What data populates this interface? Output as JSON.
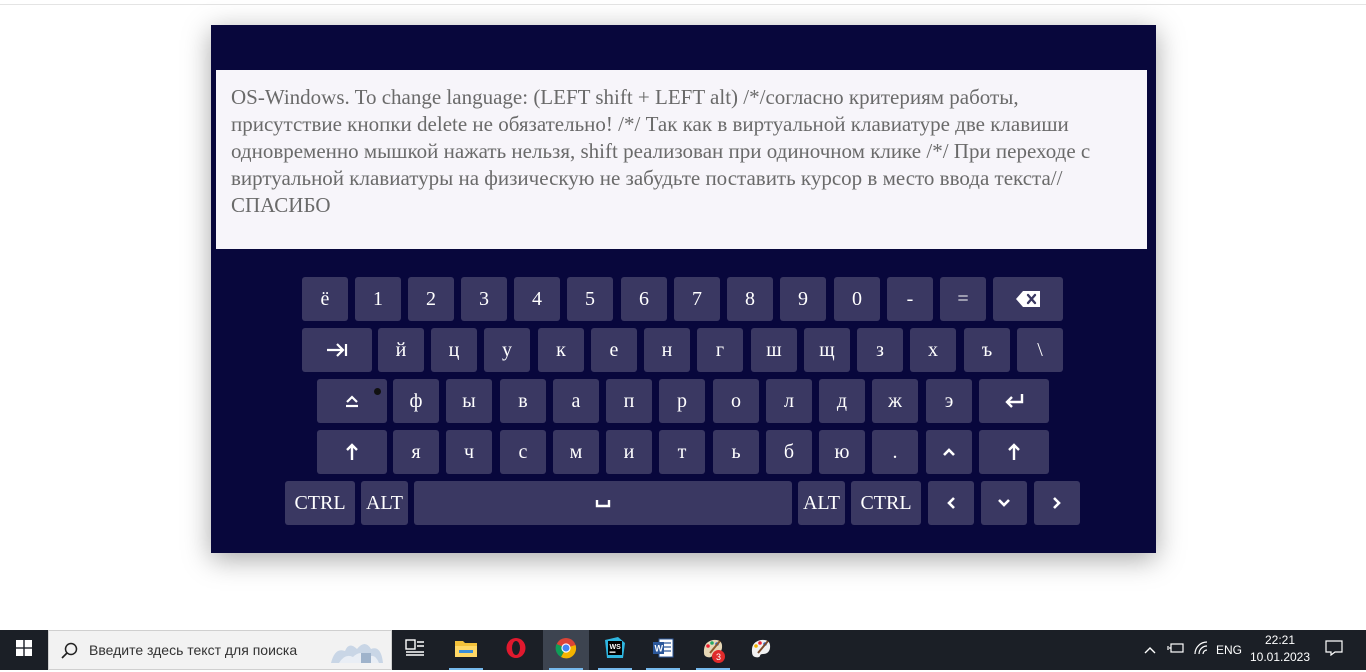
{
  "instructions_text": "OS-Windows. To change language: (LEFT shift + LEFT alt) /*/согласно критериям работы, присутствие кнопки delete не обязательно! /*/ Так как в виртуальной клавиатуре две клавиши одновременно мышкой нажать нельзя, shift реализован при одиночном клике /*/ При переходе с виртуальной клавиатуры на физическую не забудьте поставить курсор в место ввода текста// СПАСИБО",
  "keyboard": {
    "row1": [
      "ё",
      "1",
      "2",
      "3",
      "4",
      "5",
      "6",
      "7",
      "8",
      "9",
      "0",
      "-",
      "="
    ],
    "row2": [
      "й",
      "ц",
      "у",
      "к",
      "е",
      "н",
      "г",
      "ш",
      "щ",
      "з",
      "х",
      "ъ",
      "\\"
    ],
    "row3": [
      "ф",
      "ы",
      "в",
      "а",
      "п",
      "р",
      "о",
      "л",
      "д",
      "ж",
      "э"
    ],
    "row4": [
      "я",
      "ч",
      "с",
      "м",
      "и",
      "т",
      "ь",
      "б",
      "ю",
      "."
    ],
    "row5": [
      "CTRL",
      "ALT",
      "ALT",
      "CTRL"
    ],
    "icons": {
      "backspace": "backspace-icon",
      "tab": "tab-icon",
      "capslock": "capslock-icon",
      "enter": "enter-icon",
      "shift": "shift-arrow-icon",
      "space": "space-icon",
      "up": "chevron-up-icon",
      "left": "chevron-left-icon",
      "down": "chevron-down-icon",
      "right": "chevron-right-icon"
    }
  },
  "taskbar": {
    "search_placeholder": "Введите здесь текст для поиска",
    "language": "ENG",
    "time": "22:21",
    "date": "10.01.2023",
    "notification_count": "3",
    "apps": [
      "task-view-icon",
      "file-explorer-icon",
      "opera-icon",
      "chrome-icon",
      "webstorm-icon",
      "word-icon",
      "paint-icon",
      "paint-3d-icon"
    ]
  }
}
